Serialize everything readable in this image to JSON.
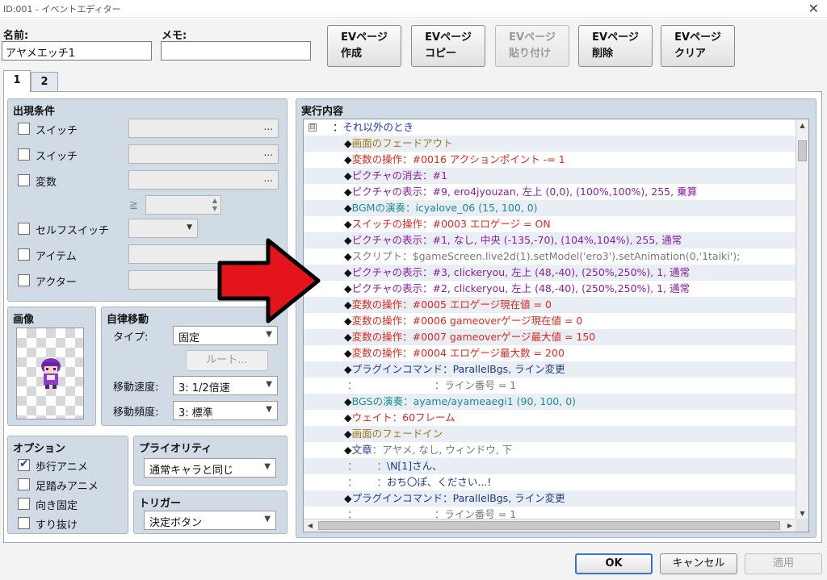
{
  "window": {
    "title": "ID:001 - イベントエディター",
    "close_glyph": "✕"
  },
  "header": {
    "name_label": "名前:",
    "name_value": "アヤメエッチ1",
    "memo_label": "メモ:",
    "memo_value": ""
  },
  "ev_buttons": [
    {
      "line1": "EVページ",
      "line2": "作成",
      "enabled": true
    },
    {
      "line1": "EVページ",
      "line2": "コピー",
      "enabled": true
    },
    {
      "line1": "EVページ",
      "line2": "貼り付け",
      "enabled": false
    },
    {
      "line1": "EVページ",
      "line2": "削除",
      "enabled": true
    },
    {
      "line1": "EVページ",
      "line2": "クリア",
      "enabled": true
    }
  ],
  "tabs": [
    {
      "label": "1",
      "active": true
    },
    {
      "label": "2",
      "active": false
    }
  ],
  "conditions": {
    "title": "出現条件",
    "items": [
      {
        "label": "スイッチ",
        "checked": false
      },
      {
        "label": "スイッチ",
        "checked": false
      },
      {
        "label": "変数",
        "checked": false
      },
      {
        "label": "セルフスイッチ",
        "checked": false
      },
      {
        "label": "アイテム",
        "checked": false
      },
      {
        "label": "アクター",
        "checked": false
      }
    ],
    "ellipsis": "...",
    "gte": "≧"
  },
  "image": {
    "title": "画像"
  },
  "autonomous": {
    "title": "自律移動",
    "type_label": "タイプ:",
    "type_value": "固定",
    "route_button": "ルート...",
    "speed_label": "移動速度:",
    "speed_value": "3: 1/2倍速",
    "freq_label": "移動頻度:",
    "freq_value": "3: 標準"
  },
  "options": {
    "title": "オプション",
    "items": [
      {
        "label": "歩行アニメ",
        "checked": true
      },
      {
        "label": "足踏みアニメ",
        "checked": false
      },
      {
        "label": "向き固定",
        "checked": false
      },
      {
        "label": "すり抜け",
        "checked": false
      }
    ]
  },
  "priority": {
    "title": "プライオリティ",
    "value": "通常キャラと同じ"
  },
  "trigger": {
    "title": "トリガー",
    "value": "決定ボタン"
  },
  "contents": {
    "title": "実行内容",
    "collapse_glyph": "⊟",
    "rows": [
      {
        "kind": "head",
        "parts": [
          {
            "t": "：",
            "c": "dark"
          },
          {
            "t": "それ以外のとき",
            "c": "blue"
          }
        ]
      },
      {
        "kind": "cmd",
        "parts": [
          {
            "t": "◆",
            "c": "dark"
          },
          {
            "t": "画面のフェードアウト",
            "c": "gold"
          }
        ]
      },
      {
        "kind": "cmd",
        "parts": [
          {
            "t": "◆",
            "c": "dark"
          },
          {
            "t": "変数の操作：#0016 アクションポイント -= 1",
            "c": "red"
          }
        ]
      },
      {
        "kind": "cmd",
        "parts": [
          {
            "t": "◆",
            "c": "dark"
          },
          {
            "t": "ピクチャの消去：#1",
            "c": "purple"
          }
        ]
      },
      {
        "kind": "cmd",
        "parts": [
          {
            "t": "◆",
            "c": "dark"
          },
          {
            "t": "ピクチャの表示：#9, ero4jyouzan, 左上 (0,0), (100%,100%), 255, 乗算",
            "c": "purple"
          }
        ]
      },
      {
        "kind": "cmd",
        "parts": [
          {
            "t": "◆",
            "c": "dark"
          },
          {
            "t": "BGMの演奏：icyalove_06 (15, 100, 0)",
            "c": "teal"
          }
        ]
      },
      {
        "kind": "cmd",
        "parts": [
          {
            "t": "◆",
            "c": "dark"
          },
          {
            "t": "スイッチの操作：#0003 エロゲージ = ON",
            "c": "red"
          }
        ]
      },
      {
        "kind": "cmd",
        "parts": [
          {
            "t": "◆",
            "c": "dark"
          },
          {
            "t": "ピクチャの表示：#1, なし, 中央 (-135,-70), (104%,104%), 255, 通常",
            "c": "purple"
          }
        ]
      },
      {
        "kind": "cmd",
        "parts": [
          {
            "t": "◆",
            "c": "dark"
          },
          {
            "t": "スクリプト：",
            "c": "gray"
          },
          {
            "t": "$gameScreen.live2d(1).setModel('ero3').setAnimation(0,'1taiki');",
            "c": "gray"
          }
        ]
      },
      {
        "kind": "cmd",
        "parts": [
          {
            "t": "◆",
            "c": "dark"
          },
          {
            "t": "ピクチャの表示：#3, clickeryou, 左上 (48,-40), (250%,250%), 1, 通常",
            "c": "purple"
          }
        ]
      },
      {
        "kind": "cmd",
        "parts": [
          {
            "t": "◆",
            "c": "dark"
          },
          {
            "t": "ピクチャの表示：#2, clickeryou, 左上 (48,-40), (250%,250%), 1, 通常",
            "c": "purple"
          }
        ]
      },
      {
        "kind": "cmd",
        "parts": [
          {
            "t": "◆",
            "c": "dark"
          },
          {
            "t": "変数の操作：#0005 エロゲージ現在値 = 0",
            "c": "red"
          }
        ]
      },
      {
        "kind": "cmd",
        "parts": [
          {
            "t": "◆",
            "c": "dark"
          },
          {
            "t": "変数の操作：#0006 gameoverゲージ現在値 = 0",
            "c": "red"
          }
        ]
      },
      {
        "kind": "cmd",
        "parts": [
          {
            "t": "◆",
            "c": "dark"
          },
          {
            "t": "変数の操作：#0007 gameoverゲージ最大値 = 150",
            "c": "red"
          }
        ]
      },
      {
        "kind": "cmd",
        "parts": [
          {
            "t": "◆",
            "c": "dark"
          },
          {
            "t": "変数の操作：#0004 エロゲージ最大数 = 200",
            "c": "red"
          }
        ]
      },
      {
        "kind": "cmd",
        "parts": [
          {
            "t": "◆",
            "c": "dark"
          },
          {
            "t": "プラグインコマンド：ParallelBgs, ライン変更",
            "c": "navy"
          }
        ]
      },
      {
        "kind": "cont",
        "parts": [
          {
            "t": "：",
            "c": "gray"
          },
          {
            "t": "                        ：ライン番号 = 1",
            "c": "gray"
          }
        ]
      },
      {
        "kind": "cmd",
        "parts": [
          {
            "t": "◆",
            "c": "dark"
          },
          {
            "t": "BGSの演奏：ayame/ayameaegi1 (90, 100, 0)",
            "c": "teal"
          }
        ]
      },
      {
        "kind": "cmd",
        "parts": [
          {
            "t": "◆",
            "c": "dark"
          },
          {
            "t": "ウェイト：60フレーム",
            "c": "red"
          }
        ]
      },
      {
        "kind": "cmd",
        "parts": [
          {
            "t": "◆",
            "c": "dark"
          },
          {
            "t": "画面のフェードイン",
            "c": "gold"
          }
        ]
      },
      {
        "kind": "cmd",
        "parts": [
          {
            "t": "◆",
            "c": "dark"
          },
          {
            "t": "文章",
            "c": "navy"
          },
          {
            "t": "：アヤメ, なし, ウィンドウ, 下",
            "c": "gray"
          }
        ]
      },
      {
        "kind": "cont",
        "parts": [
          {
            "t": "：",
            "c": "gray"
          },
          {
            "t": "      ：",
            "c": "gray"
          },
          {
            "t": "\\N[1]さん、",
            "c": "navy"
          }
        ]
      },
      {
        "kind": "cont",
        "parts": [
          {
            "t": "：",
            "c": "gray"
          },
          {
            "t": "      ：",
            "c": "gray"
          },
          {
            "t": "おち〇ぽ、ください...!",
            "c": "navy"
          }
        ]
      },
      {
        "kind": "cmd",
        "parts": [
          {
            "t": "◆",
            "c": "dark"
          },
          {
            "t": "プラグインコマンド：ParallelBgs, ライン変更",
            "c": "navy"
          }
        ]
      },
      {
        "kind": "cont",
        "parts": [
          {
            "t": "：",
            "c": "gray"
          },
          {
            "t": "                        ：ライン番号 = 1",
            "c": "gray"
          }
        ]
      }
    ]
  },
  "footer": {
    "ok": "OK",
    "cancel": "キャンセル",
    "apply": "適用"
  },
  "colors": {
    "dark": "#111111",
    "red": "#e0281e",
    "purple": "#8a1fa3",
    "gold": "#9a7a14",
    "teal": "#1b8c8c",
    "gray": "#7a7a7a",
    "navy": "#1f3a8a",
    "blue": "#1a37c9",
    "overlay_arrow": "#e3141b"
  }
}
